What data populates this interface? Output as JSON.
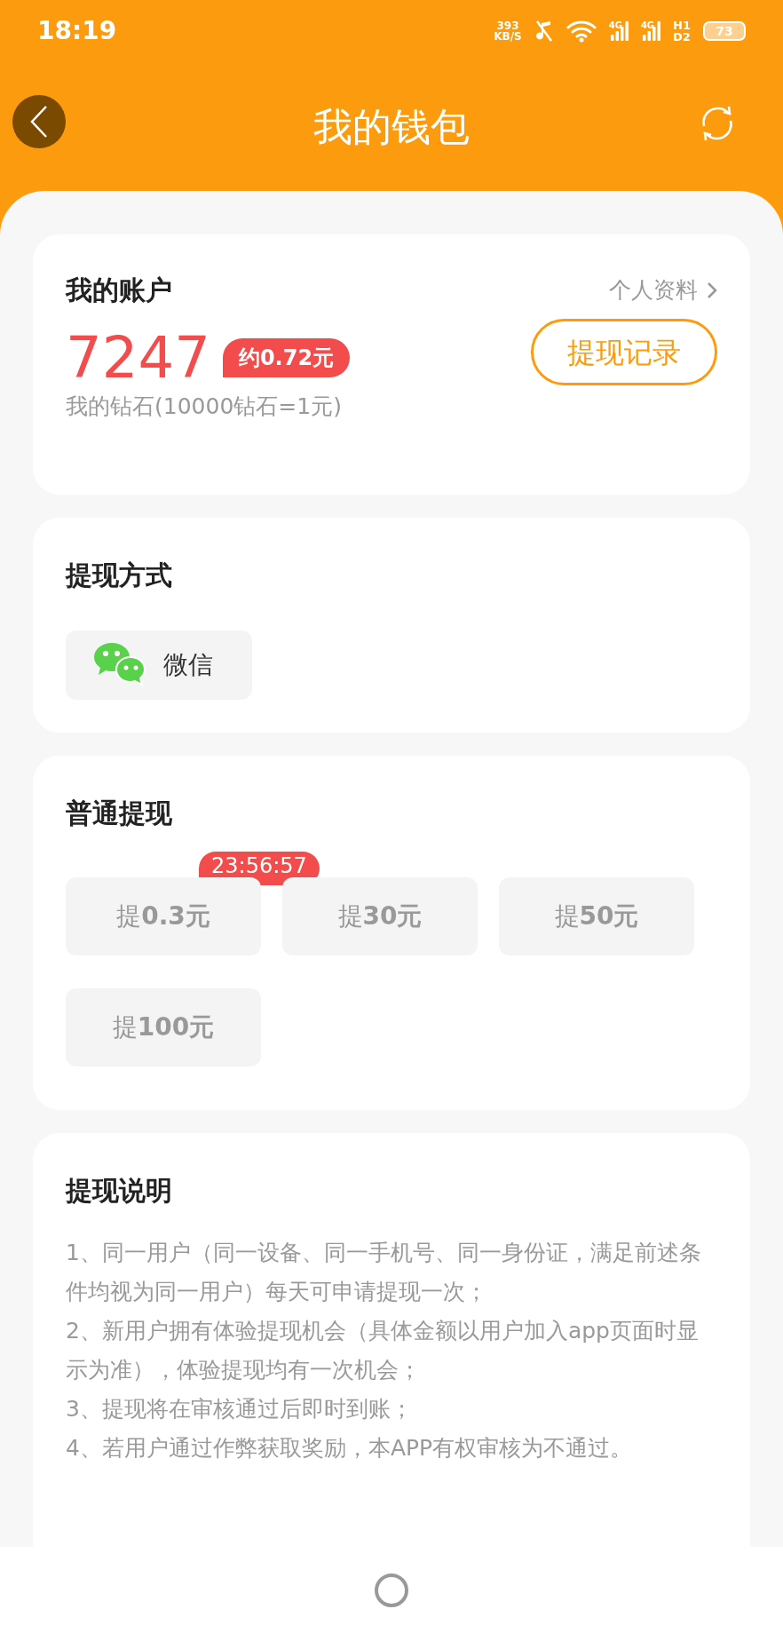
{
  "status_bar": {
    "time": "18:19",
    "speed": [
      "393",
      "KB/S"
    ],
    "networks": [
      "4G",
      "4G"
    ],
    "hd": [
      "H1",
      "D2"
    ],
    "battery": "73"
  },
  "header": {
    "title": "我的钱包"
  },
  "account": {
    "title": "我的账户",
    "profile_link": "个人资料",
    "diamonds": "7247",
    "approx": "约0.72元",
    "record_button": "提现记录",
    "caption": "我的钻石(10000钻石=1元)"
  },
  "method": {
    "title": "提现方式",
    "options": [
      {
        "label": "微信"
      }
    ]
  },
  "withdraw": {
    "title": "普通提现",
    "amounts": [
      {
        "label": "提**0.3元**",
        "timer": "23:56:57"
      },
      {
        "label": "提**30元**"
      },
      {
        "label": "提**50元**"
      },
      {
        "label": "提**100元**"
      }
    ]
  },
  "notes": {
    "title": "提现说明",
    "lines": [
      "1、同一用户（同一设备、同一手机号、同一身份证，满足前述条件均视为同一用户）每天可申请提现一次；",
      "2、新用户拥有体验提现机会（具体金额以用户加入app页面时显示为准），体验提现均有一次机会；",
      "3、提现将在审核通过后即时到账；",
      "4、若用户通过作弊获取奖励，本APP有权审核为不通过。"
    ]
  }
}
